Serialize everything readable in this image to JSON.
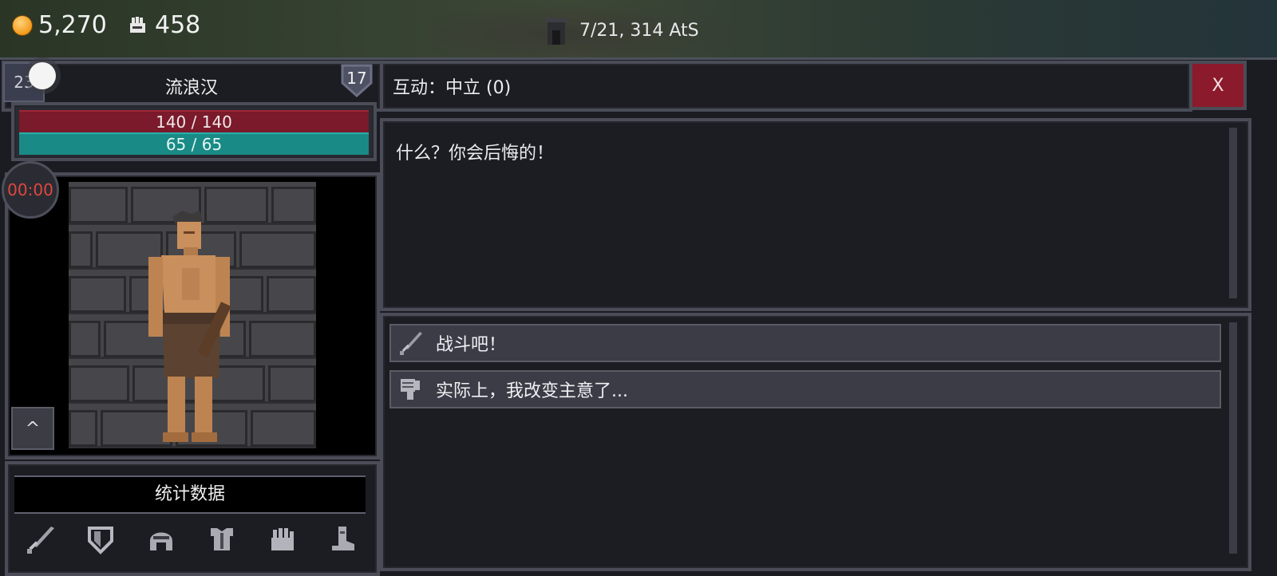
{
  "resources": {
    "gold": "5,270",
    "fist": "458",
    "date": "7/21, 314 AtS"
  },
  "character": {
    "level": "23",
    "rank": "17",
    "name": "流浪汉",
    "hp_text": "140 / 140",
    "mp_text": "65 / 65",
    "timer": "00:00",
    "up_label": "^"
  },
  "stats": {
    "header": "统计数据",
    "icons": [
      "sword-icon",
      "shield-icon",
      "helmet-icon",
      "armor-icon",
      "fist-icon",
      "boot-icon"
    ]
  },
  "interaction": {
    "title": "互动：中立 (0)",
    "close_label": "X",
    "dialog": "什么？你会后悔的！",
    "choices": [
      {
        "icon": "sword-icon",
        "label": "战斗吧！"
      },
      {
        "icon": "thumbs-down-icon",
        "label": "实际上，我改变主意了..."
      }
    ]
  },
  "colors": {
    "hp": "#7a1a2a",
    "mp": "#1a8a86",
    "close": "#8b1a2c",
    "timer_text": "#e0463f"
  }
}
